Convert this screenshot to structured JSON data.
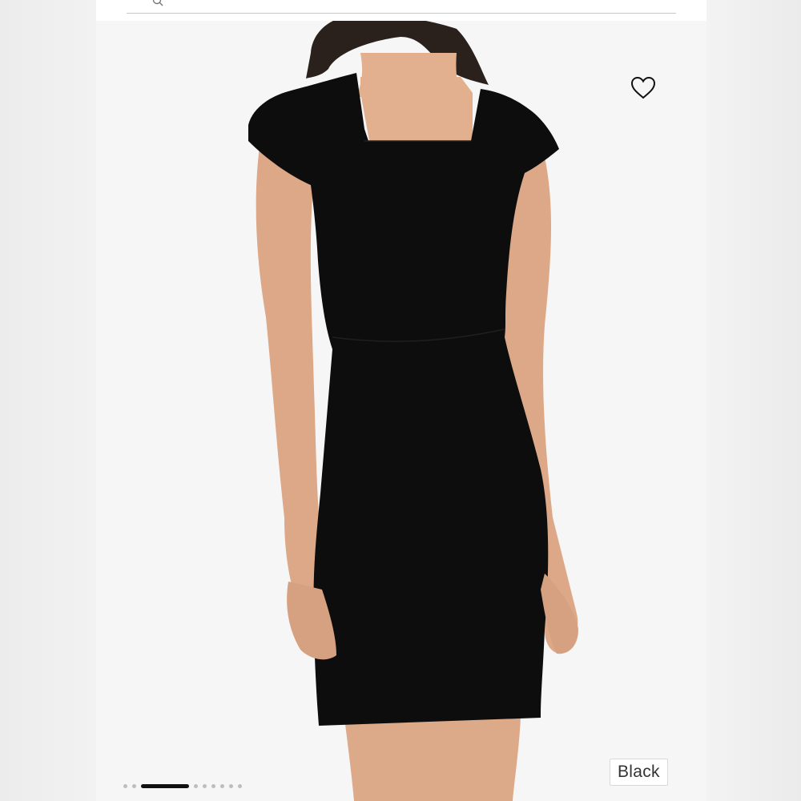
{
  "product": {
    "color_label": "Black",
    "colors": {
      "dress": "#0d0d0d",
      "skin": "#e2b08f",
      "hair": "#2a211d",
      "background": "#f6f6f6"
    }
  },
  "icons": {
    "wishlist": "heart-outline-icon",
    "search": "search-icon"
  },
  "carousel": {
    "total": 9,
    "active_index": 2
  }
}
